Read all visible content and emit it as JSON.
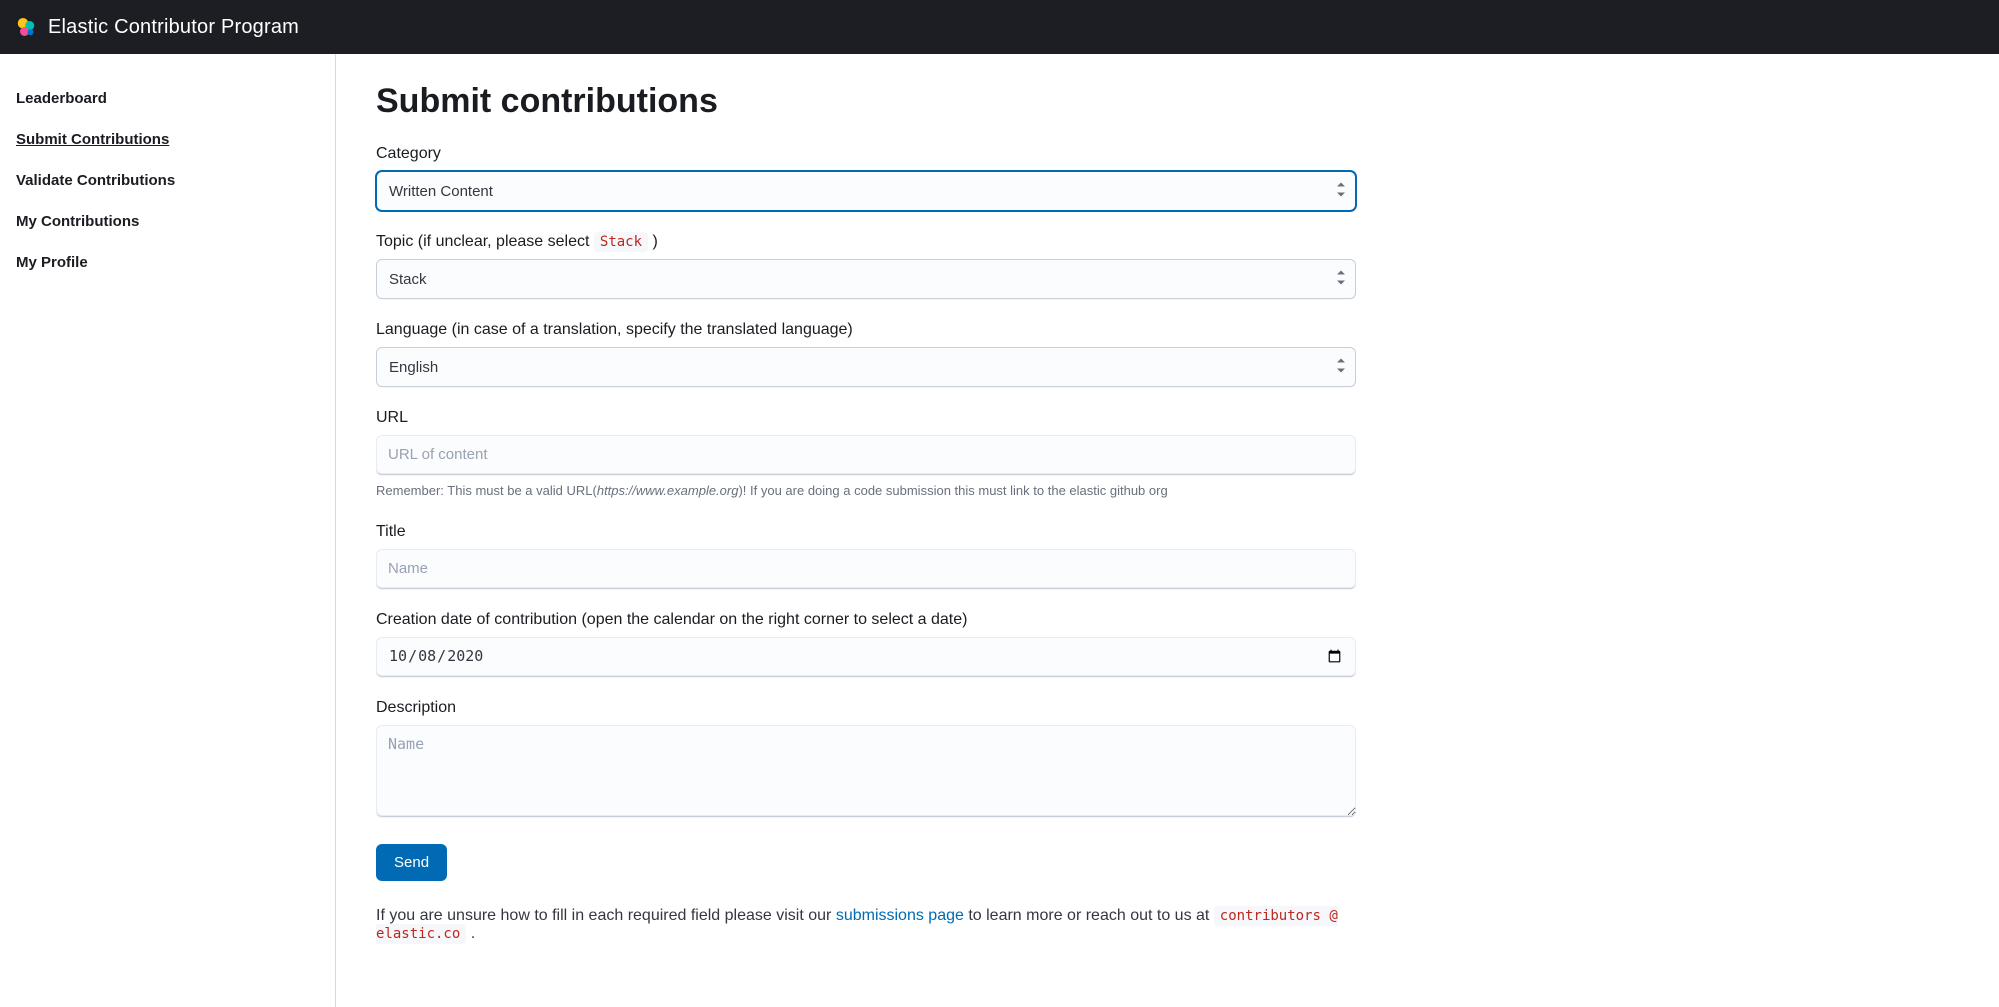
{
  "header": {
    "brand": "Elastic Contributor Program"
  },
  "sidebar": {
    "items": [
      {
        "label": "Leaderboard",
        "active": false
      },
      {
        "label": "Submit Contributions",
        "active": true
      },
      {
        "label": "Validate Contributions",
        "active": false
      },
      {
        "label": "My Contributions",
        "active": false
      },
      {
        "label": "My Profile",
        "active": false
      }
    ]
  },
  "page": {
    "title": "Submit contributions"
  },
  "form": {
    "category": {
      "label": "Category",
      "value": "Written Content"
    },
    "topic": {
      "label_pre": "Topic (if unclear, please select ",
      "label_code": "Stack",
      "label_post": " )",
      "value": "Stack"
    },
    "language": {
      "label": "Language (in case of a translation, specify the translated language)",
      "value": "English"
    },
    "url": {
      "label": "URL",
      "placeholder": "URL of content",
      "value": "",
      "help_pre": "Remember: This must be a valid URL(",
      "help_em": "https://www.example.org",
      "help_post": ")! If you are doing a code submission this must link to the elastic github org"
    },
    "title_field": {
      "label": "Title",
      "placeholder": "Name",
      "value": ""
    },
    "date": {
      "label": "Creation date of contribution (open the calendar on the right corner to select a date)",
      "value": "2020-10-08"
    },
    "description": {
      "label": "Description",
      "placeholder": "Name",
      "value": ""
    },
    "submit_label": "Send"
  },
  "footer": {
    "pre": "If you are unsure how to fill in each required field please visit our ",
    "link_text": "submissions page",
    "mid": " to learn more or reach out to us at ",
    "email_code": "contributors @ elastic.co",
    "post": " ."
  }
}
